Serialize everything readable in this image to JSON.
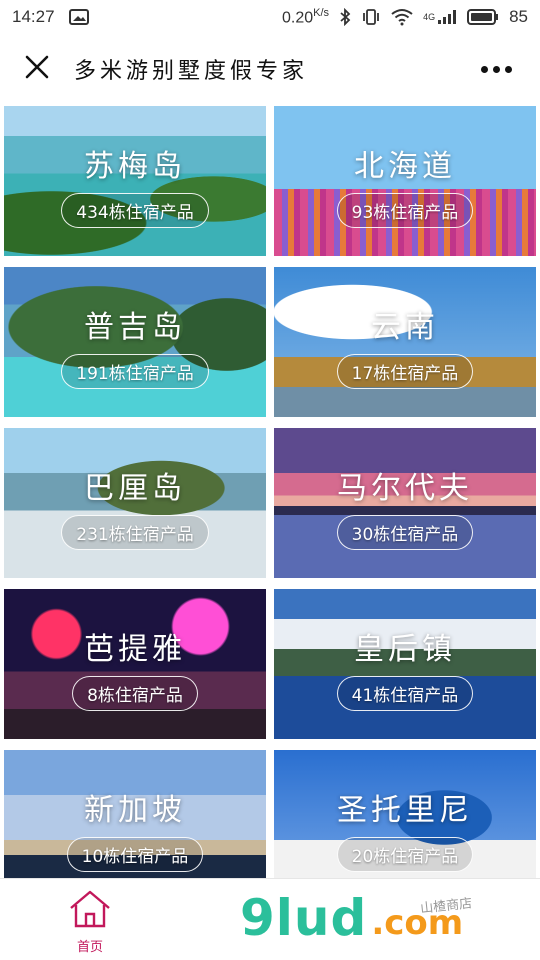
{
  "status_bar": {
    "time": "14:27",
    "speed": "0.20",
    "speed_unit": "K/s",
    "network": "4G",
    "battery": "85"
  },
  "header": {
    "close_icon": "close-icon",
    "title": "多米游别墅度假专家",
    "more_icon": "more-dots-icon"
  },
  "destinations": [
    {
      "name": "苏梅岛",
      "count": "434栋住宿产品"
    },
    {
      "name": "北海道",
      "count": "93栋住宿产品"
    },
    {
      "name": "普吉岛",
      "count": "191栋住宿产品"
    },
    {
      "name": "云南",
      "count": "17栋住宿产品"
    },
    {
      "name": "巴厘岛",
      "count": "231栋住宿产品"
    },
    {
      "name": "马尔代夫",
      "count": "30栋住宿产品"
    },
    {
      "name": "芭提雅",
      "count": "8栋住宿产品"
    },
    {
      "name": "皇后镇",
      "count": "41栋住宿产品"
    },
    {
      "name": "新加坡",
      "count": "10栋住宿产品"
    },
    {
      "name": "圣托里尼",
      "count": "20栋住宿产品"
    }
  ],
  "bottom_nav": {
    "home_label": "首页",
    "home_icon": "home-icon"
  },
  "watermark": {
    "main": "9lud",
    "suffix": ".com",
    "stamp": "山楂商店"
  },
  "colors": {
    "accent": "#c2185b",
    "watermark_green": "#2bbf9b",
    "watermark_orange": "#f49a1b"
  }
}
